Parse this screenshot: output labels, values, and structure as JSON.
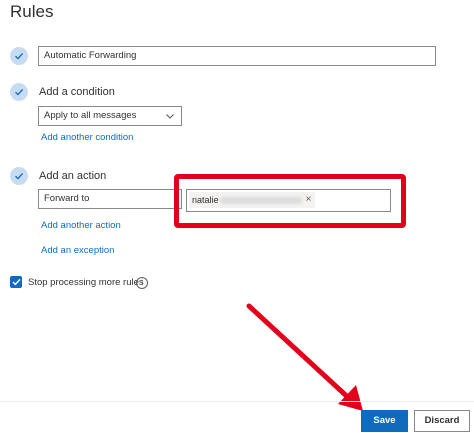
{
  "page": {
    "title": "Rules"
  },
  "rule_name": {
    "value": "Automatic Forwarding"
  },
  "condition": {
    "heading": "Add a condition",
    "selected": "Apply to all messages",
    "add_link": "Add another condition"
  },
  "action": {
    "heading": "Add an action",
    "selected": "Forward to",
    "recipient_visible": "natalie",
    "remove_glyph": "×",
    "add_link": "Add another action"
  },
  "exception": {
    "add_link": "Add an exception"
  },
  "stop_processing": {
    "label": "Stop processing more rules",
    "checked": true,
    "info_glyph": "i"
  },
  "footer": {
    "save_label": "Save",
    "discard_label": "Discard"
  },
  "colors": {
    "accent": "#0f6cbd",
    "annotation_red": "#e3001b",
    "step_circle": "#c7dcf3"
  }
}
